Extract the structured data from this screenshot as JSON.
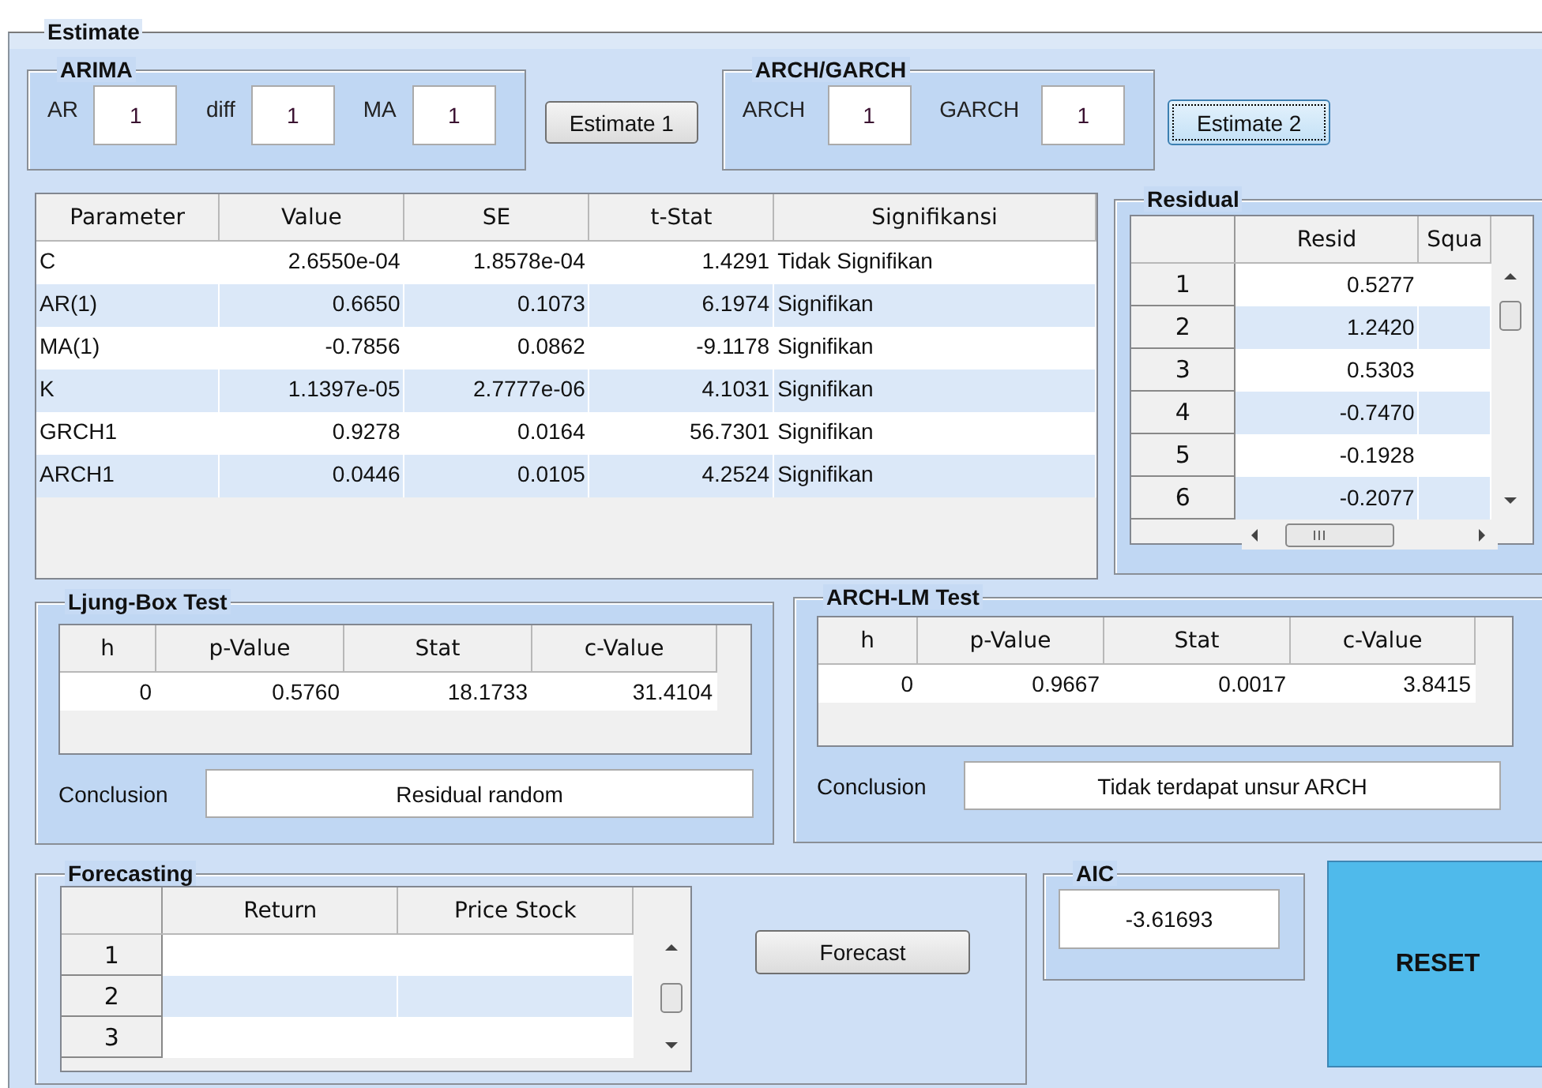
{
  "panel": {
    "title": "Estimate"
  },
  "arima": {
    "title": "ARIMA",
    "fields": [
      {
        "label": "AR",
        "value": "1"
      },
      {
        "label": "diff",
        "value": "1"
      },
      {
        "label": "MA",
        "value": "1"
      }
    ]
  },
  "estimate_1": {
    "label": "Estimate 1",
    "focused": false
  },
  "arch_garch": {
    "title": "ARCH/GARCH",
    "fields": [
      {
        "label": "ARCH",
        "value": "1"
      },
      {
        "label": "GARCH",
        "value": "1"
      }
    ]
  },
  "estimate_2": {
    "label": "Estimate 2",
    "focused": true
  },
  "parameters": {
    "columns": [
      "Parameter",
      "Value",
      "SE",
      "t-Stat",
      "Signifikansi"
    ],
    "rows": [
      [
        "C",
        "2.6550e-04",
        "1.8578e-04",
        "1.4291",
        "Tidak Signifikan"
      ],
      [
        "AR(1)",
        "0.6650",
        "0.1073",
        "6.1974",
        "Signifikan"
      ],
      [
        "MA(1)",
        "-0.7856",
        "0.0862",
        "-9.1178",
        "Signifikan"
      ],
      [
        "K",
        "1.1397e-05",
        "2.7777e-06",
        "4.1031",
        "Signifikan"
      ],
      [
        "GRCH1",
        "0.9278",
        "0.0164",
        "56.7301",
        "Signifikan"
      ],
      [
        "ARCH1",
        "0.0446",
        "0.0105",
        "4.2524",
        "Signifikan"
      ]
    ]
  },
  "residual": {
    "title": "Residual",
    "columns": [
      "Resid",
      "Squa"
    ],
    "rows": [
      {
        "label": "1",
        "resid": "0.5277"
      },
      {
        "label": "2",
        "resid": "1.2420"
      },
      {
        "label": "3",
        "resid": "0.5303"
      },
      {
        "label": "4",
        "resid": "-0.7470"
      },
      {
        "label": "5",
        "resid": "-0.1928"
      },
      {
        "label": "6",
        "resid": "-0.2077"
      }
    ]
  },
  "ljung_box": {
    "title": "Ljung-Box Test",
    "columns": [
      "h",
      "p-Value",
      "Stat",
      "c-Value"
    ],
    "rows": [
      [
        "0",
        "0.5760",
        "18.1733",
        "31.4104"
      ]
    ],
    "conclusion_label": "Conclusion",
    "conclusion": "Residual random"
  },
  "arch_lm": {
    "title": "ARCH-LM Test",
    "columns": [
      "h",
      "p-Value",
      "Stat",
      "c-Value"
    ],
    "rows": [
      [
        "0",
        "0.9667",
        "0.0017",
        "3.8415"
      ]
    ],
    "conclusion_label": "Conclusion",
    "conclusion": "Tidak terdapat unsur ARCH"
  },
  "forecasting": {
    "title": "Forecasting",
    "columns": [
      "Return",
      "Price Stock"
    ],
    "rows": [
      "1",
      "2",
      "3"
    ],
    "button": "Forecast"
  },
  "aic": {
    "title": "AIC",
    "value": "-3.61693"
  },
  "reset": "RESET"
}
